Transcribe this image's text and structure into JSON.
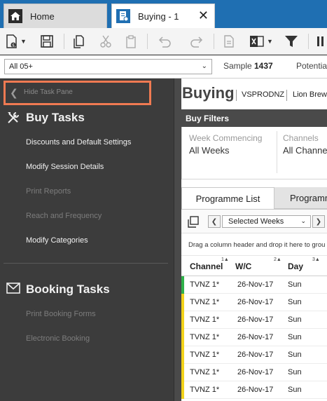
{
  "tabs": {
    "home_label": "Home",
    "active_label": "Buying - 1",
    "close_glyph": "✕"
  },
  "toolbar": {
    "icons": [
      "new-document-icon",
      "save-icon",
      "copy-icon",
      "cut-icon",
      "paste-icon",
      "undo-icon",
      "redo-icon",
      "document-icon",
      "excel-icon",
      "filter-icon",
      "more-icon"
    ]
  },
  "filterbar": {
    "demo_value": "All 05+",
    "sample_label": "Sample",
    "sample_value": "1437",
    "potential_label": "Potential"
  },
  "task_pane": {
    "hide_label": "Hide Task Pane",
    "buy_tasks": {
      "title": "Buy Tasks",
      "items": [
        {
          "label": "Discounts and Default Settings",
          "enabled": true
        },
        {
          "label": "Modify Session Details",
          "enabled": true
        },
        {
          "label": "Print Reports",
          "enabled": false
        },
        {
          "label": "Reach and Frequency",
          "enabled": false
        },
        {
          "label": "Modify Categories",
          "enabled": true
        }
      ]
    },
    "booking_tasks": {
      "title": "Booking Tasks",
      "items": [
        {
          "label": "Print Booking Forms",
          "enabled": false
        },
        {
          "label": "Electronic Booking",
          "enabled": false
        }
      ]
    }
  },
  "main": {
    "title": "Buying",
    "code": "VSPRODNZ",
    "client": "Lion Brew",
    "buy_filters": {
      "header": "Buy Filters",
      "week_label": "Week Commencing",
      "week_value": "All Weeks",
      "channels_label": "Channels",
      "channels_value": "All Channel"
    },
    "grid_tabs": {
      "selected": "Programme List",
      "other": "Programm"
    },
    "week_selector": "Selected Weeks",
    "drag_hint": "Drag a column header and drop it here to grou",
    "columns": [
      {
        "label": "Channel",
        "sort": "1▲"
      },
      {
        "label": "W/C",
        "sort": "2▲"
      },
      {
        "label": "Day",
        "sort": "3▲"
      }
    ],
    "rows": [
      {
        "channel": "TVNZ 1*",
        "wc": "26-Nov-17",
        "day": "Sun",
        "marker": "#2fb14a"
      },
      {
        "channel": "TVNZ 1*",
        "wc": "26-Nov-17",
        "day": "Sun",
        "marker": "#f2d21a"
      },
      {
        "channel": "TVNZ 1*",
        "wc": "26-Nov-17",
        "day": "Sun",
        "marker": "#f2d21a"
      },
      {
        "channel": "TVNZ 1*",
        "wc": "26-Nov-17",
        "day": "Sun",
        "marker": "#f2d21a"
      },
      {
        "channel": "TVNZ 1*",
        "wc": "26-Nov-17",
        "day": "Sun",
        "marker": "#f2d21a"
      },
      {
        "channel": "TVNZ 1*",
        "wc": "26-Nov-17",
        "day": "Sun",
        "marker": "#f2d21a"
      },
      {
        "channel": "TVNZ 1*",
        "wc": "26-Nov-17",
        "day": "Sun",
        "marker": "#f2d21a"
      }
    ]
  },
  "colors": {
    "accent_blue": "#1f6fb2",
    "highlight_orange": "#f07a52",
    "pane_bg": "#3c3c3c"
  }
}
